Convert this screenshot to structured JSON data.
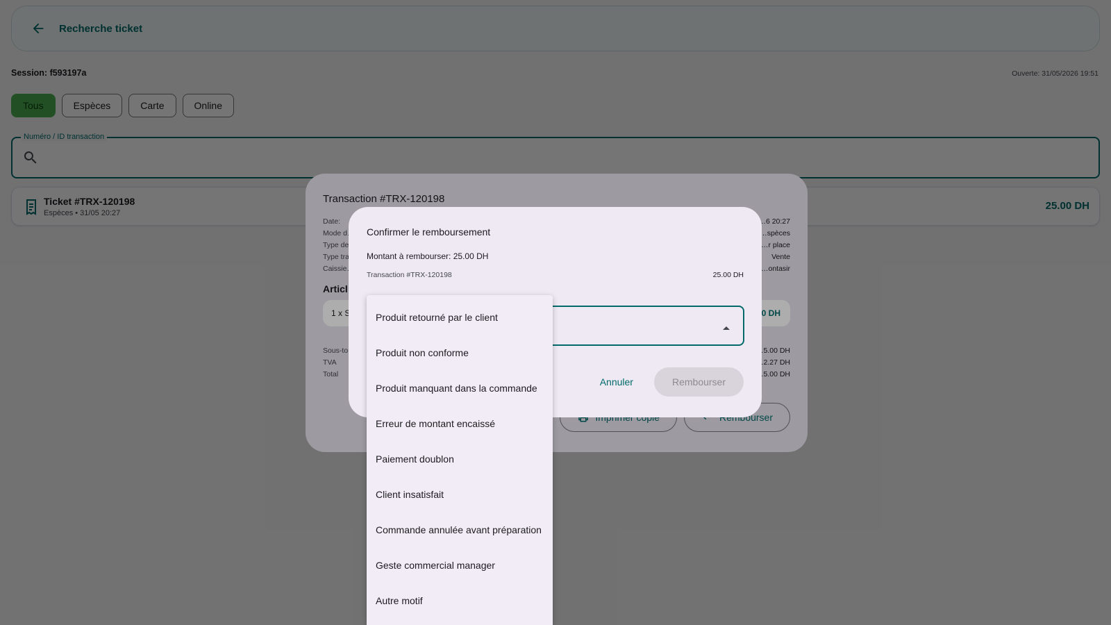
{
  "header": {
    "title": "Recherche ticket"
  },
  "session": {
    "label": "Session: f593197a",
    "opened": "Ouverte: 31/05/2026 19:51"
  },
  "filters": [
    "Tous",
    "Espèces",
    "Carte",
    "Online"
  ],
  "search": {
    "label": "Numéro / ID transaction",
    "value": ""
  },
  "ticket": {
    "title": "Ticket #TRX-120198",
    "subtitle": "Espèces • 31/05 20:27",
    "amount": "25.00 DH"
  },
  "detail_dialog": {
    "title": "Transaction #TRX-120198",
    "rows": [
      {
        "label": "Date:",
        "value": "…6 20:27"
      },
      {
        "label": "Mode d…",
        "value": "…spèces"
      },
      {
        "label": "Type de…",
        "value": "…r place"
      },
      {
        "label": "Type tra…",
        "value": "Vente"
      },
      {
        "label": "Caissie…",
        "value": "…ontasir"
      }
    ],
    "section": "Articl…",
    "item": {
      "label": "1 x S…",
      "amount": "…0 DH"
    },
    "totals": [
      {
        "label": "Sous-to…",
        "value": "…5.00 DH"
      },
      {
        "label": "TVA",
        "value": "…2.27 DH"
      },
      {
        "label": "Total",
        "value": "…5.00 DH"
      }
    ],
    "print_button": "Imprimer copie",
    "refund_button": "Rembourser"
  },
  "confirm_dialog": {
    "title": "Confirmer le remboursement",
    "amount_line": "Montant à rembourser: 25.00 DH",
    "transaction": "Transaction #TRX-120198",
    "transaction_amount": "25.00 DH",
    "cancel": "Annuler",
    "confirm": "Rembourser"
  },
  "reason_menu": [
    "Produit retourné par le client",
    "Produit non conforme",
    "Produit manquant dans la commande",
    "Erreur de montant encaissé",
    "Paiement doublon",
    "Client insatisfait",
    "Commande annulée avant préparation",
    "Geste commercial manager",
    "Autre motif"
  ],
  "colors": {
    "accent": "#006a6a",
    "active_filter": "#4caf50"
  }
}
